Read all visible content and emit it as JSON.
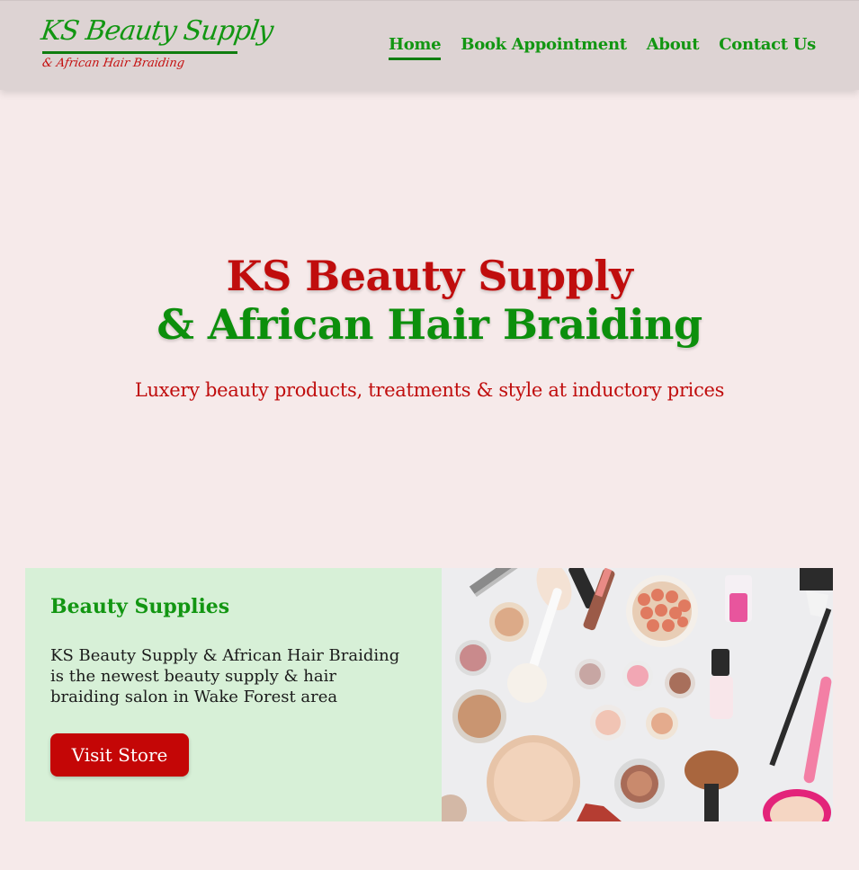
{
  "logo": {
    "main": "KS Beauty Supply",
    "sub": "& African Hair Braiding"
  },
  "nav": {
    "items": [
      {
        "label": "Home",
        "active": true
      },
      {
        "label": "Book Appointment",
        "active": false
      },
      {
        "label": "About",
        "active": false
      },
      {
        "label": "Contact Us",
        "active": false
      }
    ]
  },
  "hero": {
    "title_line1": "KS Beauty Supply",
    "title_line2": "& African Hair Braiding",
    "subtitle": "Luxery beauty products, treatments & style at inductory prices"
  },
  "card": {
    "title": "Beauty Supplies",
    "text": "KS Beauty Supply & African Hair Braiding is the newest beauty supply & hair braiding salon in Wake Forest area",
    "button_label": "Visit Store"
  },
  "colors": {
    "brand_green": "#129612",
    "brand_red": "#c00d0d",
    "header_bg": "#ddd3d3",
    "page_bg": "#f6eaea",
    "card_bg": "#d7f0d7"
  }
}
